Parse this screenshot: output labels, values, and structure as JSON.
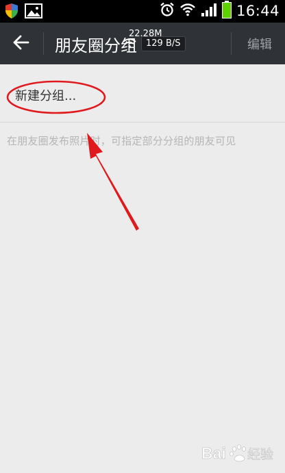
{
  "status_bar": {
    "time": "16:44",
    "battery_color": "#5fd000",
    "icons": [
      "shield-app-icon",
      "image-icon",
      "alarm-icon",
      "wifi-icon",
      "signal-icon",
      "battery-icon"
    ]
  },
  "action_bar": {
    "title": "朋友圈分组",
    "edit_label": "编辑",
    "speed_overlay": {
      "memory": "22.28M",
      "speed": "129 B/S"
    }
  },
  "content": {
    "new_group_label": "新建分组...",
    "hint": "在朋友圈发布照片时，可指定部分分组的朋友可见"
  },
  "annotations": {
    "ellipse_color": "#e0191c",
    "arrow_color": "#e0191c"
  },
  "watermark": {
    "brand_latin": "Bai",
    "brand_cn": "经验",
    "brand_color": "#ffffff"
  }
}
